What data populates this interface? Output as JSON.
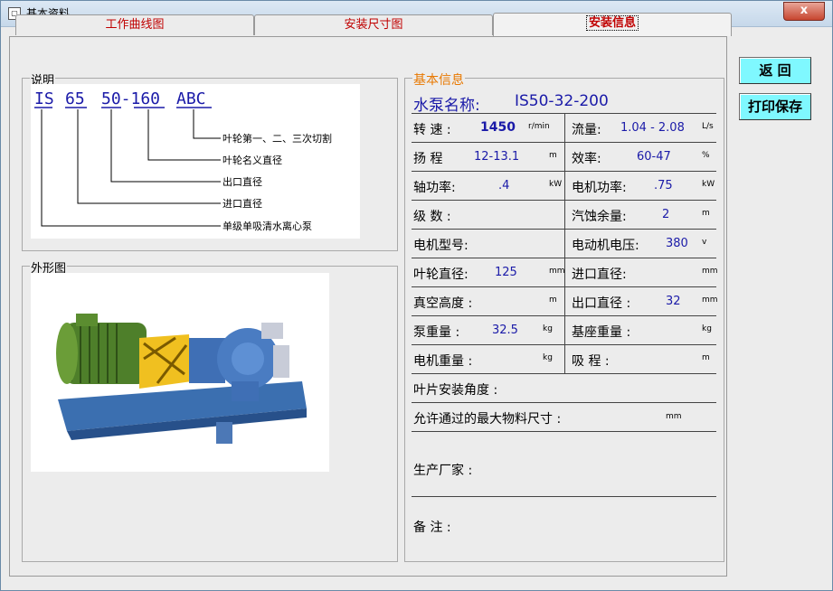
{
  "window": {
    "title": "基本资料",
    "close": "x"
  },
  "tabs": [
    "工作曲线图",
    "安装尺寸图",
    "安装信息"
  ],
  "buttons": {
    "back": "返  回",
    "print_save": "打印保存"
  },
  "description": {
    "legend": "说明",
    "model_parts": [
      "IS",
      "65",
      "50-160",
      "ABC"
    ],
    "explanations": [
      "叶轮第一、二、三次切割",
      "叶轮名义直径",
      "出口直径",
      "进口直径",
      "单级单吸清水离心泵"
    ]
  },
  "appearance": {
    "legend": "外形图"
  },
  "info": {
    "legend": "基本信息",
    "pump_name_label": "水泵名称:",
    "pump_name_value": "IS50-32-200",
    "rows": [
      {
        "left_label": "转 速 :",
        "left_value": "1450",
        "left_unit": "r/min",
        "right_label": "流量:",
        "right_value": "1.04 - 2.08",
        "right_unit": "L/s"
      },
      {
        "left_label": "扬 程",
        "left_value": "12-13.1",
        "left_unit": "m",
        "right_label": "效率:",
        "right_value": "60-47",
        "right_unit": "%"
      },
      {
        "left_label": "轴功率:",
        "left_value": ".4",
        "left_unit": "kW",
        "right_label": "电机功率:",
        "right_value": ".75",
        "right_unit": "kW"
      },
      {
        "left_label": "级 数 :",
        "left_value": "",
        "left_unit": "",
        "right_label": "汽蚀余量:",
        "right_value": "2",
        "right_unit": "m"
      },
      {
        "left_label": "电机型号:",
        "left_value": "",
        "left_unit": "",
        "right_label": "电动机电压:",
        "right_value": "380",
        "right_unit": "v"
      },
      {
        "left_label": "叶轮直径:",
        "left_value": "125",
        "left_unit": "mm",
        "right_label": "进口直径:",
        "right_value": "",
        "right_unit": "mm"
      },
      {
        "left_label": "真空高度 :",
        "left_value": "",
        "left_unit": "m",
        "right_label": "出口直径 :",
        "right_value": "32",
        "right_unit": "mm"
      },
      {
        "left_label": "泵重量 :",
        "left_value": "32.5",
        "left_unit": "kg",
        "right_label": "基座重量 :",
        "right_value": "",
        "right_unit": "kg"
      },
      {
        "left_label": "电机重量 :",
        "left_value": "",
        "left_unit": "kg",
        "right_label": "吸 程 :",
        "right_value": "",
        "right_unit": "m"
      }
    ],
    "blade_angle_label": "叶片安装角度 :",
    "max_material_label": "允许通过的最大物料尺寸 :",
    "max_material_unit": "mm",
    "manufacturer_label": "生产厂家 :",
    "remark_label": "备  注 :"
  }
}
